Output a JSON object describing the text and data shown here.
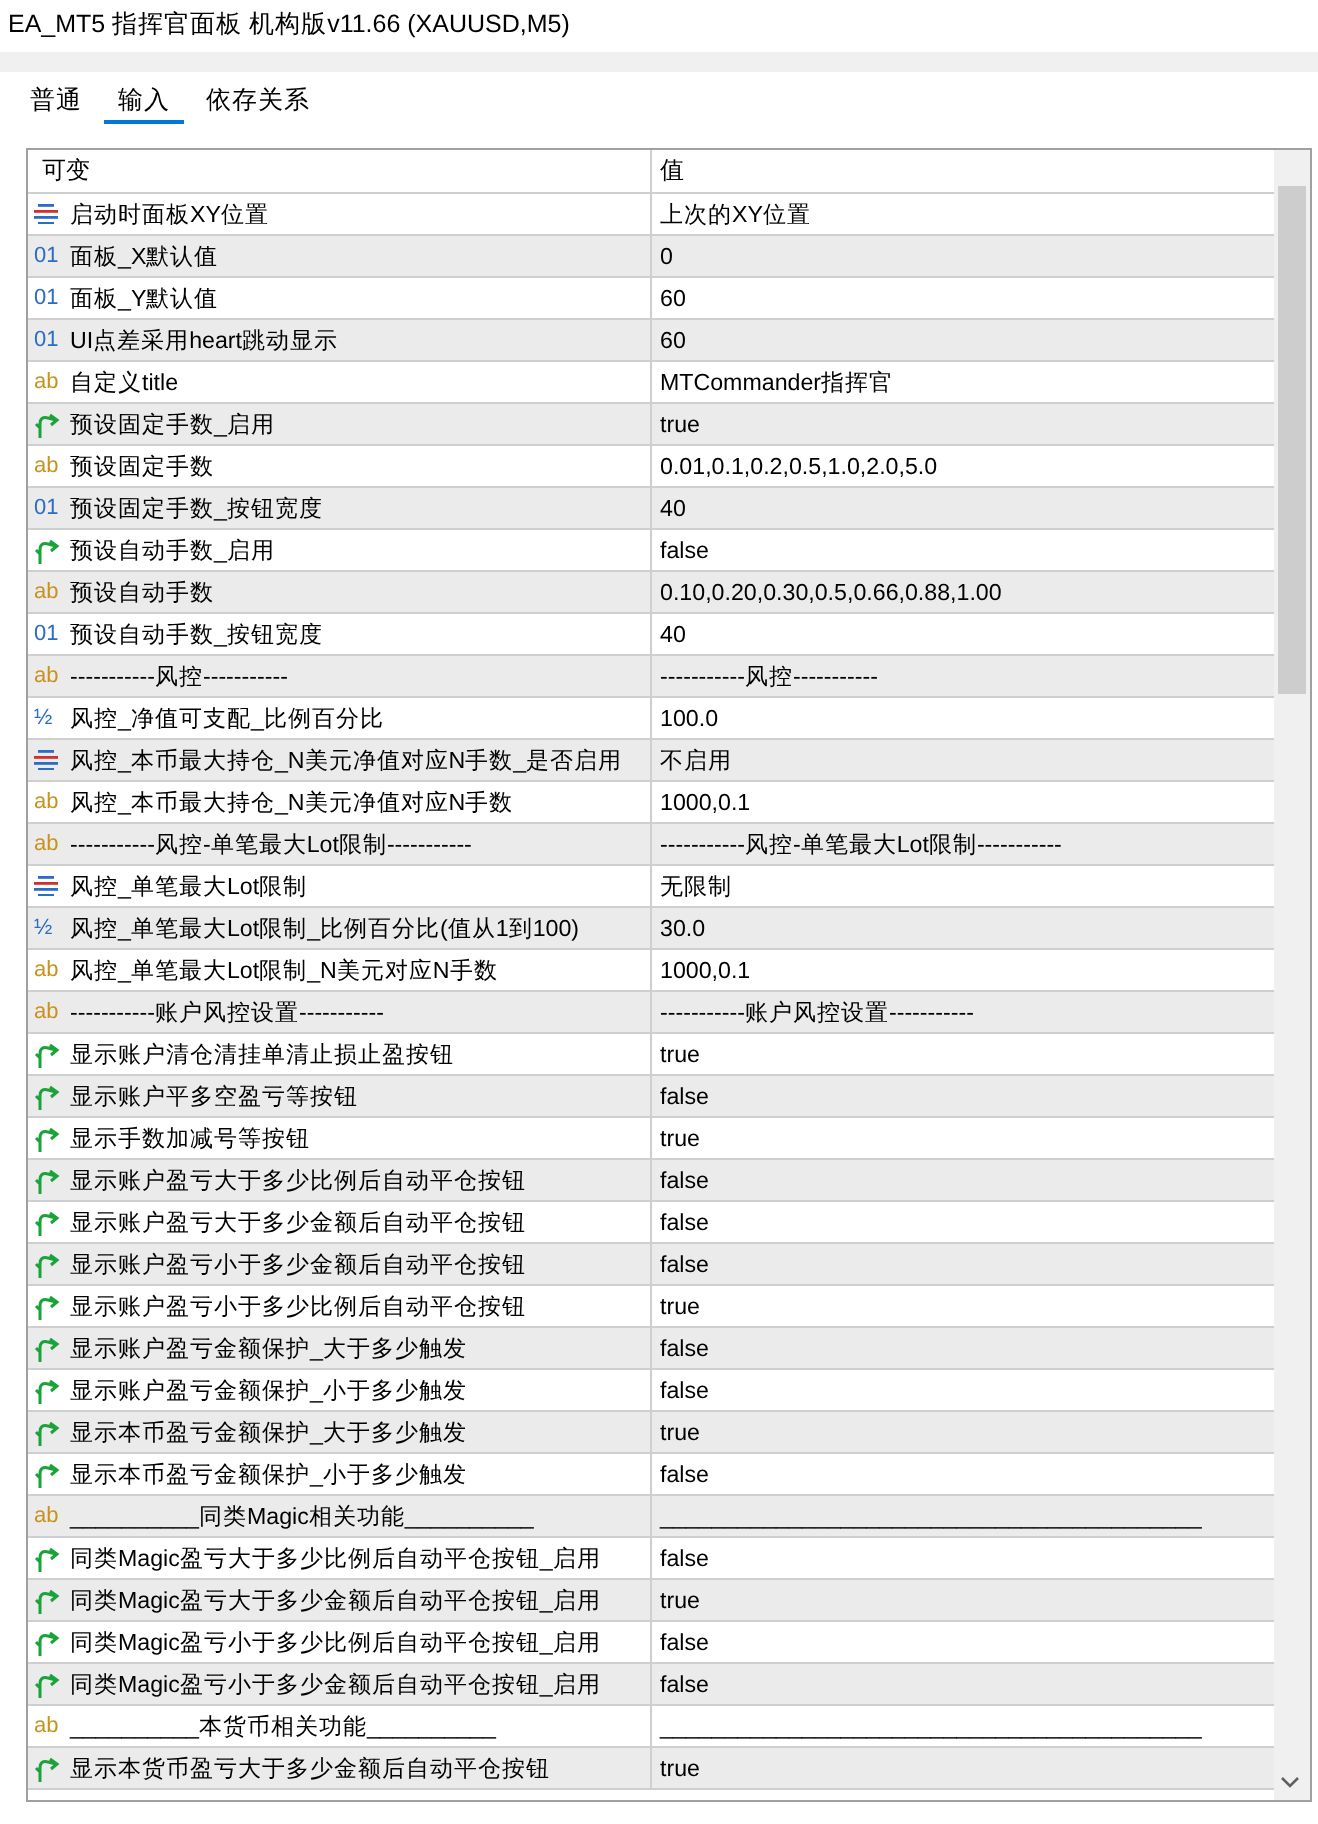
{
  "window": {
    "title": "EA_MT5 指挥官面板 机构版v11.66 (XAUUSD,M5)"
  },
  "tabs": [
    {
      "label": "普通",
      "selected": false
    },
    {
      "label": "输入",
      "selected": true
    },
    {
      "label": "依存关系",
      "selected": false
    }
  ],
  "table": {
    "columns": [
      "可变",
      "值"
    ],
    "rows": [
      {
        "kind": "enum",
        "name": "启动时面板XY位置",
        "value": "上次的XY位置"
      },
      {
        "kind": "int",
        "type_mark": "01",
        "name": "面板_X默认值",
        "value": "0"
      },
      {
        "kind": "int",
        "type_mark": "01",
        "name": "面板_Y默认值",
        "value": "60"
      },
      {
        "kind": "int",
        "type_mark": "01",
        "name": "UI点差采用heart跳动显示",
        "value": "60"
      },
      {
        "kind": "string",
        "type_mark": "ab",
        "name": "自定义title",
        "value": "MTCommander指挥官"
      },
      {
        "kind": "bool",
        "name": "预设固定手数_启用",
        "value": "true"
      },
      {
        "kind": "string",
        "type_mark": "ab",
        "name": "预设固定手数",
        "value": "0.01,0.1,0.2,0.5,1.0,2.0,5.0"
      },
      {
        "kind": "int",
        "type_mark": "01",
        "name": "预设固定手数_按钮宽度",
        "value": "40"
      },
      {
        "kind": "bool",
        "name": "预设自动手数_启用",
        "value": "false"
      },
      {
        "kind": "string",
        "type_mark": "ab",
        "name": "预设自动手数",
        "value": "0.10,0.20,0.30,0.5,0.66,0.88,1.00"
      },
      {
        "kind": "int",
        "type_mark": "01",
        "name": "预设自动手数_按钮宽度",
        "value": "40"
      },
      {
        "kind": "string",
        "type_mark": "ab",
        "name": "-----------风控-----------",
        "value": "-----------风控-----------"
      },
      {
        "kind": "double",
        "type_mark": "½",
        "name": "风控_净值可支配_比例百分比",
        "value": "100.0"
      },
      {
        "kind": "enum",
        "name": "风控_本币最大持仓_N美元净值对应N手数_是否启用",
        "value": "不启用"
      },
      {
        "kind": "string",
        "type_mark": "ab",
        "name": "风控_本币最大持仓_N美元净值对应N手数",
        "value": "1000,0.1"
      },
      {
        "kind": "string",
        "type_mark": "ab",
        "name": "-----------风控-单笔最大Lot限制-----------",
        "value": "-----------风控-单笔最大Lot限制-----------"
      },
      {
        "kind": "enum",
        "name": "风控_单笔最大Lot限制",
        "value": "无限制"
      },
      {
        "kind": "double",
        "type_mark": "½",
        "name": "风控_单笔最大Lot限制_比例百分比(值从1到100)",
        "value": "30.0"
      },
      {
        "kind": "string",
        "type_mark": "ab",
        "name": "风控_单笔最大Lot限制_N美元对应N手数",
        "value": "1000,0.1"
      },
      {
        "kind": "string",
        "type_mark": "ab",
        "name": "-----------账户风控设置-----------",
        "value": "-----------账户风控设置-----------"
      },
      {
        "kind": "bool",
        "name": "显示账户清仓清挂单清止损止盈按钮",
        "value": "true"
      },
      {
        "kind": "bool",
        "name": "显示账户平多空盈亏等按钮",
        "value": "false"
      },
      {
        "kind": "bool",
        "name": "显示手数加减号等按钮",
        "value": "true"
      },
      {
        "kind": "bool",
        "name": "显示账户盈亏大于多少比例后自动平仓按钮",
        "value": "false"
      },
      {
        "kind": "bool",
        "name": "显示账户盈亏大于多少金额后自动平仓按钮",
        "value": "false"
      },
      {
        "kind": "bool",
        "name": "显示账户盈亏小于多少金额后自动平仓按钮",
        "value": "false"
      },
      {
        "kind": "bool",
        "name": "显示账户盈亏小于多少比例后自动平仓按钮",
        "value": "true"
      },
      {
        "kind": "bool",
        "name": "显示账户盈亏金额保护_大于多少触发",
        "value": "false"
      },
      {
        "kind": "bool",
        "name": "显示账户盈亏金额保护_小于多少触发",
        "value": "false"
      },
      {
        "kind": "bool",
        "name": "显示本币盈亏金额保护_大于多少触发",
        "value": "true"
      },
      {
        "kind": "bool",
        "name": "显示本币盈亏金额保护_小于多少触发",
        "value": "false"
      },
      {
        "kind": "string",
        "type_mark": "ab",
        "name": "__________同类Magic相关功能__________",
        "value": "__________________________________________"
      },
      {
        "kind": "bool",
        "name": "同类Magic盈亏大于多少比例后自动平仓按钮_启用",
        "value": "false"
      },
      {
        "kind": "bool",
        "name": "同类Magic盈亏大于多少金额后自动平仓按钮_启用",
        "value": "true"
      },
      {
        "kind": "bool",
        "name": "同类Magic盈亏小于多少比例后自动平仓按钮_启用",
        "value": "false"
      },
      {
        "kind": "bool",
        "name": "同类Magic盈亏小于多少金额后自动平仓按钮_启用",
        "value": "false"
      },
      {
        "kind": "string",
        "type_mark": "ab",
        "name": "__________本货币相关功能__________",
        "value": "__________________________________________"
      },
      {
        "kind": "bool",
        "name": "显示本货币盈亏大于多少金额后自动平仓按钮",
        "value": "true"
      }
    ]
  }
}
